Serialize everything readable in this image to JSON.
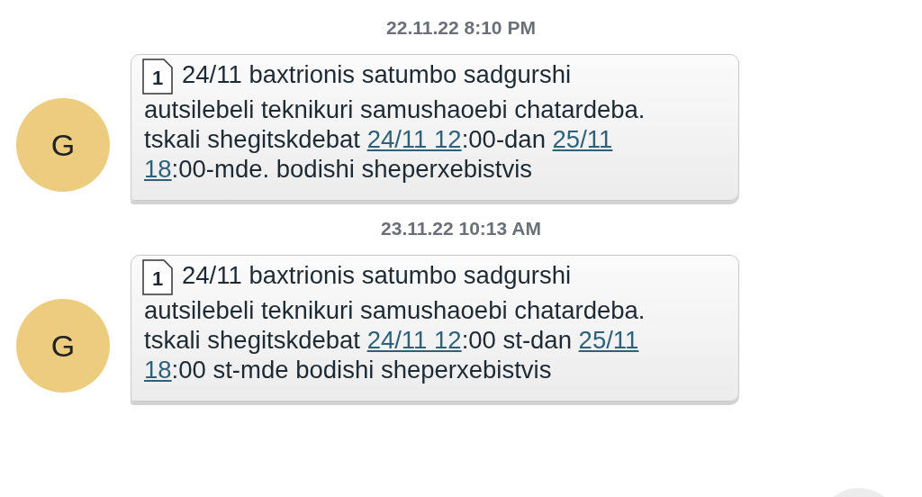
{
  "messages": [
    {
      "date": "22.11.22 8:10 PM",
      "avatar": "G",
      "sim": "1",
      "segments": [
        {
          "kind": "text",
          "text": "24/11 baxtrionis satumbo sadgurshi autsilebeli teknikuri samushaoebi chatardeba. tskali shegitskdebat "
        },
        {
          "kind": "link",
          "text": "24/11 12"
        },
        {
          "kind": "text",
          "text": ":00-dan "
        },
        {
          "kind": "link",
          "text": "25/11"
        },
        {
          "kind": "link",
          "text": "18"
        },
        {
          "kind": "text",
          "text": ":00-mde. bodishi sheperxebistvis"
        }
      ]
    },
    {
      "date": "23.11.22 10:13 AM",
      "avatar": "G",
      "sim": "1",
      "segments": [
        {
          "kind": "text",
          "text": "24/11 baxtrionis satumbo sadgurshi autsilebeli teknikuri samushaoebi chatardeba. tskali shegitskdebat "
        },
        {
          "kind": "link",
          "text": "24/11 12"
        },
        {
          "kind": "text",
          "text": ":00 st-dan "
        },
        {
          "kind": "link",
          "text": "25/11"
        },
        {
          "kind": "link",
          "text": "18"
        },
        {
          "kind": "text",
          "text": ":00 st-mde bodishi sheperxebistvis"
        }
      ]
    }
  ]
}
